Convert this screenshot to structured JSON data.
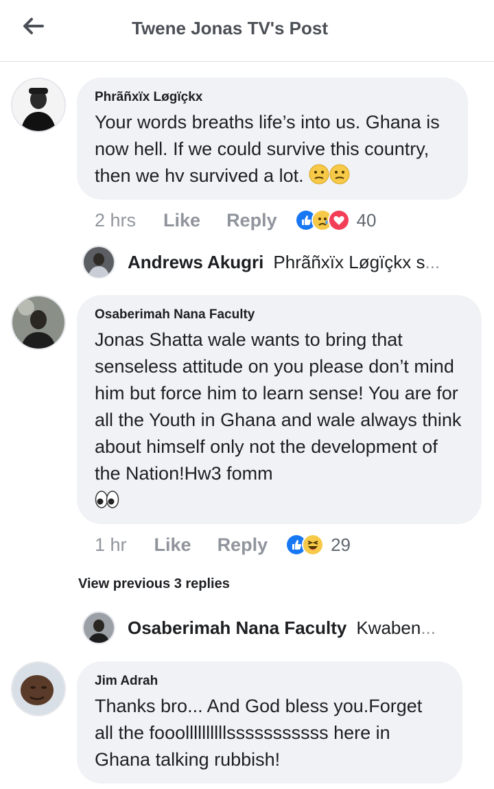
{
  "header": {
    "title": "Twene Jonas TV's Post",
    "back_icon": "back-arrow-icon"
  },
  "comments": [
    {
      "author": "Phrãñxïx Løgïçkx",
      "text": "Your words breaths life’s into us. Ghana is now hell. If we could survive this country, then we hv survived a lot.",
      "emojis": [
        "confused-face",
        "confused-face"
      ],
      "time": "2 hrs",
      "like_label": "Like",
      "reply_label": "Reply",
      "reactions": [
        "like",
        "sad",
        "love"
      ],
      "reaction_count": "40"
    },
    {
      "author": "Osaberimah Nana Faculty",
      "text": "Jonas Shatta wale wants to bring that senseless attitude on you please don’t mind him but force him to learn sense! You are for all the Youth in Ghana and wale always think about himself only not the development of the Nation!Hw3 fomm",
      "emojis": [
        "eyes"
      ],
      "time": "1 hr",
      "like_label": "Like",
      "reply_label": "Reply",
      "reactions": [
        "like",
        "haha"
      ],
      "reaction_count": "29"
    },
    {
      "author": "Jim Adrah",
      "text": "Thanks bro... And God bless you.Forget all the fooollllllllllsssssssssss here in Ghana talking rubbish!"
    }
  ],
  "replies": [
    {
      "name": "Andrews Akugri",
      "snippet": "Phrãñxïx Løgïçkx s",
      "ellipsis": "..."
    },
    {
      "name": "Osaberimah Nana Faculty",
      "snippet": "Kwaben",
      "ellipsis": "..."
    }
  ],
  "view_previous": "View previous 3 replies",
  "colors": {
    "like_blue": "#1877f2",
    "love_red": "#f33e58",
    "emoji_yellow": "#f7c948",
    "bubble_bg": "#f0f2f5",
    "meta_gray": "#90949c"
  }
}
